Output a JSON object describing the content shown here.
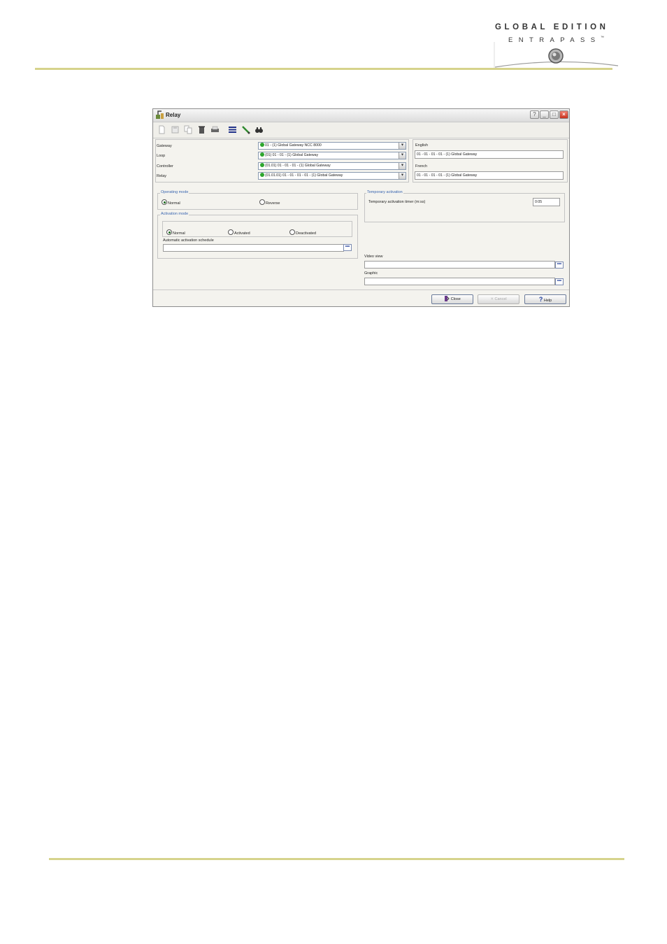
{
  "header": {
    "logo_line1": "GLOBAL EDITION",
    "logo_line2": "ENTRAPASS",
    "logo_trademark": "™"
  },
  "window": {
    "title": "Relay",
    "title_buttons": [
      "?",
      "_",
      "□",
      "×"
    ]
  },
  "toolbar": {
    "icons": [
      "new-icon",
      "save-icon",
      "copy-icon",
      "delete-icon",
      "print-icon",
      "list-icon",
      "link-icon",
      "find-icon"
    ]
  },
  "selectors": {
    "gateway_label": "Gateway",
    "gateway_value": "01 - (1)  Global Gateway NCC 8000",
    "loop_label": "Loop",
    "loop_value": "(01) 01 - 01 - (1)  Global Gateway",
    "controller_label": "Controller",
    "controller_value": "(01.01) 01 - 01 - 01 - (1)  Global Gateway",
    "relay_label": "Relay",
    "relay_value": "(01.01.01) 01 - 01 - 01 - 01 - (1)  Global Gateway",
    "status_color": "#2fa62f"
  },
  "names": {
    "english_label": "English",
    "english_value": "01 - 01 - 01 - 01 - (1)  Global Gateway",
    "french_label": "French",
    "french_value": "01 - 01 - 01 - 01 - (1)  Global Gateway"
  },
  "operating_mode": {
    "legend": "Operating mode",
    "normal": "Normal",
    "reverse": "Reverse",
    "selected": "Normal"
  },
  "activation_mode": {
    "legend": "Activation mode",
    "normal": "Normal",
    "activated": "Activated",
    "deactivated": "Deactivated",
    "selected": "Normal",
    "schedule_label": "Automatic activation schedule",
    "schedule_value": ""
  },
  "temporary_activation": {
    "legend": "Temporary activation",
    "timer_label": "Temporary activation timer (m:ss)",
    "timer_value": "0:05"
  },
  "video_view": {
    "label": "Video view",
    "value": ""
  },
  "graphic": {
    "label": "Graphic",
    "value": ""
  },
  "ellipsis_label": "•••",
  "buttons": {
    "close": "Close",
    "cancel": "Cancel",
    "help": "Help"
  },
  "colors": {
    "header_rule": "#d6d38c",
    "legend_text": "#3a66b0"
  }
}
